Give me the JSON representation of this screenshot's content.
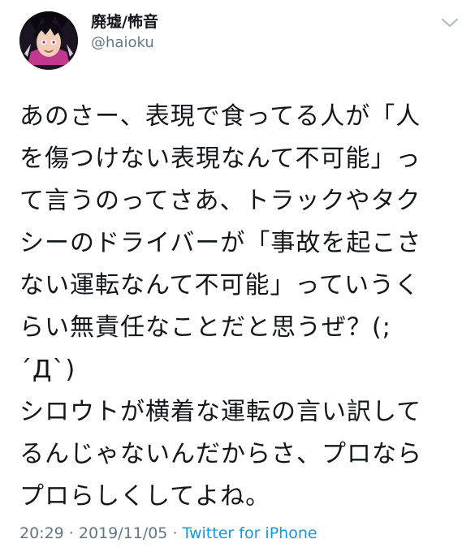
{
  "header": {
    "display_name": "廃墟/怖音",
    "handle": "@haioku"
  },
  "tweet": {
    "lines": [
      "あのさー、表現で食ってる人が「人",
      "を傷つけない表現なんて不可能」っ",
      "て言うのってさあ、トラックやタク",
      "シーのドライバーが「事故を起こさ",
      "ない運転なんて不可能」っていうく",
      "らい無責任なことだと思うぜ？(;",
      "´Д`)",
      "シロウトが横着な運転の言い訳して",
      "るんじゃないんだからさ、プロなら",
      "プロらしくしてよね。"
    ]
  },
  "meta": {
    "time": "20:29",
    "separator": " · ",
    "date": "2019/11/05",
    "source": "Twitter for iPhone"
  },
  "colors": {
    "text": "#14171a",
    "secondary": "#657786",
    "link": "#1b95e0"
  },
  "icons": {
    "chevron": "chevron-down-icon"
  }
}
